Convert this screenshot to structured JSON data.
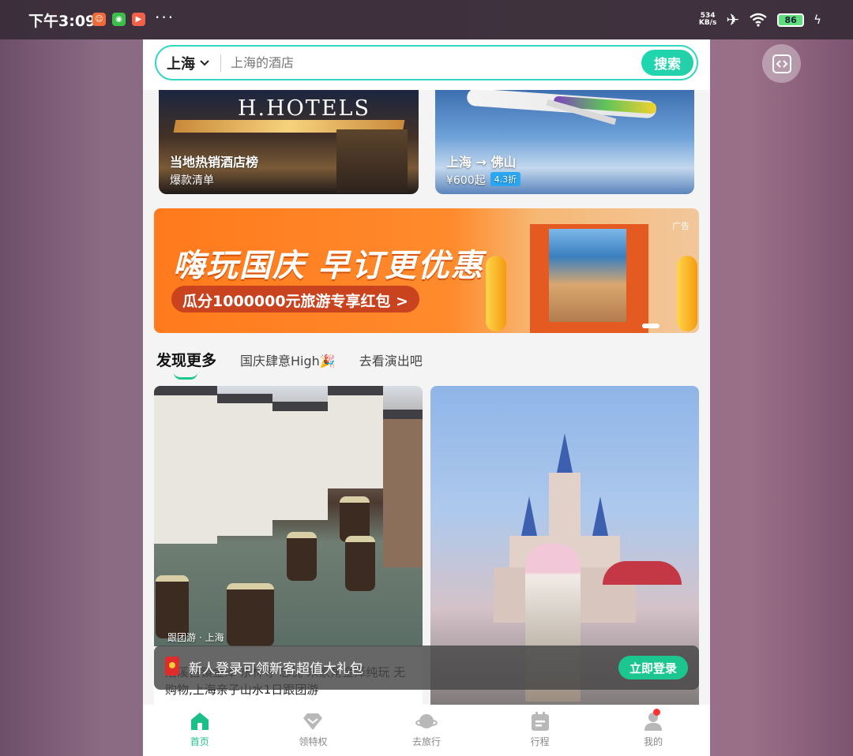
{
  "status_bar": {
    "time": "下午3:09",
    "net_speed_value": "534",
    "net_speed_unit": "KB/s",
    "battery": "86",
    "more": "···"
  },
  "search": {
    "city": "上海",
    "placeholder": "上海的酒店",
    "button_label": "搜索"
  },
  "top_cards": [
    {
      "sign": "H.HOTELS",
      "title": "当地热销酒店榜",
      "subtitle": "爆款清单"
    },
    {
      "title": "上海 → 佛山",
      "price": "¥600起",
      "discount": "4.3折"
    }
  ],
  "banner": {
    "title": "嗨玩国庆 早订更优惠",
    "subtitle": "瓜分1000000元旅游专享红包 >",
    "ad_label": "广告"
  },
  "discover_tabs": [
    {
      "label": "发现更多"
    },
    {
      "label": "国庆肆意High🎉"
    },
    {
      "label": "去看演出吧"
    }
  ],
  "feed": [
    {
      "tag": "跟团游 · 上海",
      "caption": "漕溪古镇金泽·东林寺·忘忧·朱家角金泽纯玩 无购物,上海亲子山水1日跟团游"
    },
    {
      "tag": "",
      "caption": ""
    }
  ],
  "login_toast": {
    "text": "新人登录可领新客超值大礼包",
    "button_label": "立即登录"
  },
  "tabbar": [
    {
      "label": "首页",
      "icon": "home-icon"
    },
    {
      "label": "领特权",
      "icon": "diamond-icon"
    },
    {
      "label": "去旅行",
      "icon": "planet-icon"
    },
    {
      "label": "行程",
      "icon": "calendar-icon"
    },
    {
      "label": "我的",
      "icon": "user-icon"
    }
  ],
  "colors": {
    "accent": "#1cc78f",
    "banner_orange": "#ff7a1c"
  }
}
